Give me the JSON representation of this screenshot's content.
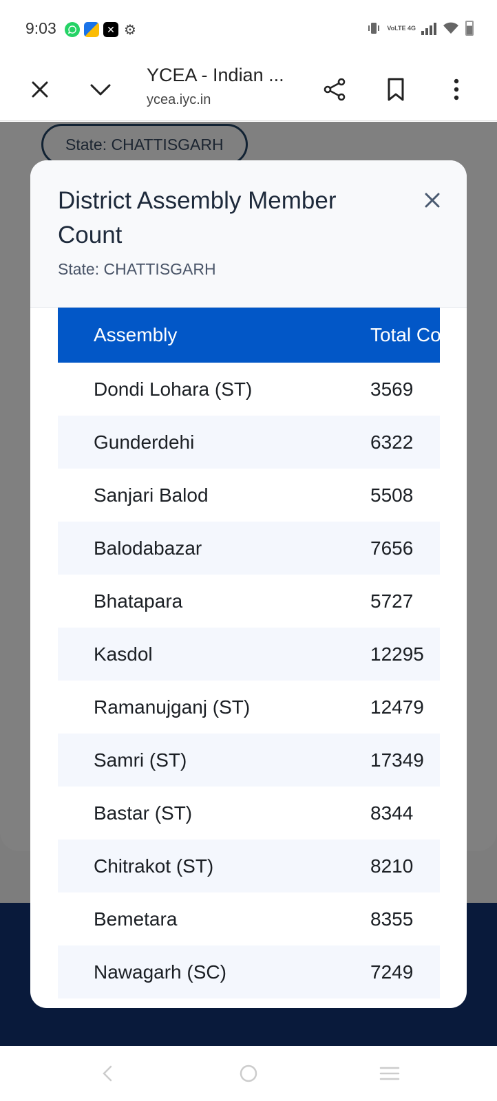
{
  "status_bar": {
    "time": "9:03",
    "notification_icons": [
      "whatsapp-icon",
      "files-icon",
      "x-icon",
      "settings-icon"
    ],
    "network_label": "VoLTE 4G"
  },
  "browser": {
    "page_title": "YCEA - Indian ...",
    "url": "ycea.iyc.in"
  },
  "background_page": {
    "state_chip": "State: CHATTISGARH"
  },
  "modal": {
    "title": "District Assembly Member Count",
    "subtitle": "State: CHATTISGARH",
    "table": {
      "headers": [
        "Assembly",
        "Total Count"
      ],
      "rows": [
        {
          "assembly": "Dondi Lohara (ST)",
          "count": "3569"
        },
        {
          "assembly": "Gunderdehi",
          "count": "6322"
        },
        {
          "assembly": "Sanjari Balod",
          "count": "5508"
        },
        {
          "assembly": "Balodabazar",
          "count": "7656"
        },
        {
          "assembly": "Bhatapara",
          "count": "5727"
        },
        {
          "assembly": "Kasdol",
          "count": "12295"
        },
        {
          "assembly": "Ramanujganj (ST)",
          "count": "12479"
        },
        {
          "assembly": "Samri (ST)",
          "count": "17349"
        },
        {
          "assembly": "Bastar (ST)",
          "count": "8344"
        },
        {
          "assembly": "Chitrakot (ST)",
          "count": "8210"
        },
        {
          "assembly": "Bemetara",
          "count": "8355"
        },
        {
          "assembly": "Nawagarh (SC)",
          "count": "7249"
        }
      ]
    }
  },
  "colors": {
    "table_header": "#0257c7",
    "row_alt": "#f4f7fd",
    "overlay": "#7d7d7d",
    "footer": "#091a3b"
  }
}
